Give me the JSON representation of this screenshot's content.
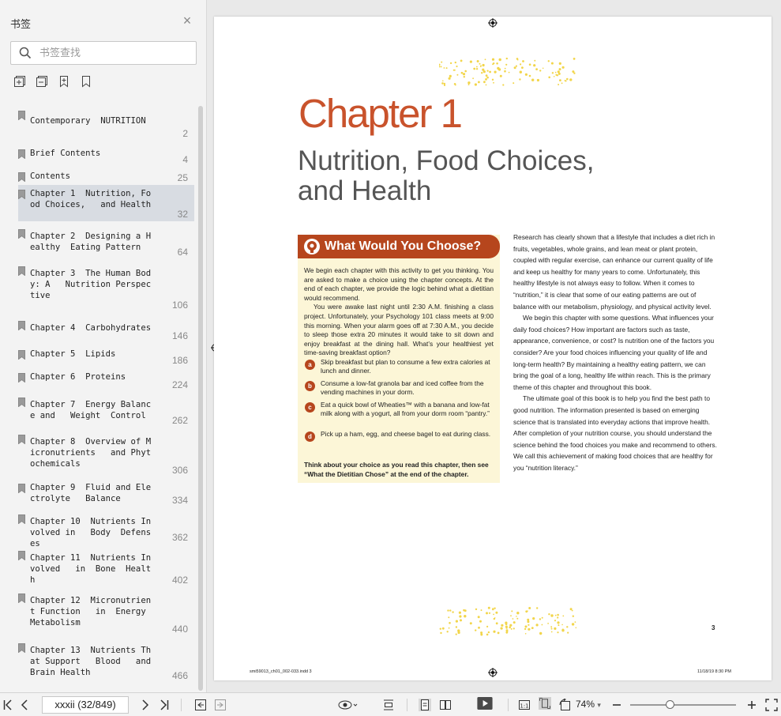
{
  "sidebar": {
    "title": "书签",
    "search_placeholder": "书签查找",
    "items": [
      {
        "lines": [
          "Contemporary  NUTRITION"
        ],
        "page": "2"
      },
      {
        "lines": [
          "Brief Contents"
        ],
        "page": "4"
      },
      {
        "lines": [
          "Contents"
        ],
        "page": "25"
      },
      {
        "lines": [
          "Chapter 1  Nutrition, Fo",
          "od Choices,   and Health"
        ],
        "page": "32",
        "selected": true
      },
      {
        "lines": [
          "Chapter 2  Designing a H",
          "ealthy  Eating Pattern"
        ],
        "page": "64"
      },
      {
        "lines": [
          "Chapter 3  The Human Bod",
          "y: A   Nutrition Perspec",
          "tive"
        ],
        "page": "106"
      },
      {
        "lines": [
          "Chapter 4  Carbohydrates"
        ],
        "page": "146"
      },
      {
        "lines": [
          "Chapter 5  Lipids"
        ],
        "page": "186"
      },
      {
        "lines": [
          "Chapter 6  Proteins"
        ],
        "page": "224"
      },
      {
        "lines": [
          "Chapter 7  Energy Balanc",
          "e and   Weight  Control"
        ],
        "page": "262"
      },
      {
        "lines": [
          "Chapter 8  Overview of M",
          "icronutrients   and Phyt",
          "ochemicals"
        ],
        "page": "306"
      },
      {
        "lines": [
          "Chapter 9  Fluid and Ele",
          "ctrolyte   Balance"
        ],
        "page": "334"
      },
      {
        "lines": [
          "Chapter 10  Nutrients In",
          "volved in   Body  Defens",
          "es"
        ],
        "page": "362"
      },
      {
        "lines": [
          "Chapter 11  Nutrients In",
          "volved   in  Bone  Healt",
          "h"
        ],
        "page": "402"
      },
      {
        "lines": [
          "Chapter 12  Micronutrien",
          "t Function   in  Energy",
          "Metabolism"
        ],
        "page": "440"
      },
      {
        "lines": [
          "Chapter 13  Nutrients Th",
          "at Support   Blood   and",
          "Brain Health"
        ],
        "page": "466"
      }
    ]
  },
  "page": {
    "chapter": "Chapter 1",
    "title_line1": "Nutrition, Food Choices,",
    "title_line2": "and Health",
    "box_title": "What Would You Choose?",
    "box_p1": "We begin each chapter with this activity to get you thinking. You are asked to make a choice using the chapter concepts. At the end of each chapter, we provide the logic behind what a dietitian would recommend.",
    "box_p2": "You were awake last night until 2:30 A.M. finishing a class project. Unfortunately, your Psychology 101 class meets at 9:00 this morning. When your alarm goes off at 7:30 A.M., you decide to sleep those extra 20 minutes it would take to sit down and enjoy breakfast at the dining hall. What’s your healthiest yet time-saving breakfast option?",
    "options": [
      {
        "letter": "a",
        "text": "Skip breakfast but plan to consume a few extra calories at lunch and dinner."
      },
      {
        "letter": "b",
        "text": "Consume a low-fat granola bar and iced coffee from the vending machines in your dorm."
      },
      {
        "letter": "c",
        "text": "Eat a quick bowl of Wheaties™ with a banana and low-fat milk along with a yogurt, all from your dorm room “pantry.”"
      },
      {
        "letter": "d",
        "text": "Pick up a ham, egg, and cheese bagel to eat during class."
      }
    ],
    "box_foot": "Think about your choice as you read this chapter, then see “What the Dietitian Chose” at the end of the chapter.",
    "right_p1": "Research has clearly shown that a lifestyle that includes a diet rich in fruits, vegetables, whole grains, and lean meat or plant protein, coupled with regular exercise, can enhance our current quality of life and keep us healthy for many years to come. Unfortunately, this healthy lifestyle is not always easy to follow. When it comes to “nutrition,” it is clear that some of our eating patterns are out of balance with our metabolism, physiology, and physical activity level.",
    "right_p2": "We begin this chapter with some questions. What influences your daily food choices? How important are factors such as taste, appearance, convenience, or cost? Is nutrition one of the factors you consider? Are your food choices influencing your quality of life and long-term health? By maintaining a healthy eating pattern, we can bring the goal of a long, healthy life within reach. This is the primary theme of this chapter and throughout this book.",
    "right_p3": "The ultimate goal of this book is to help you find the best path to good nutrition. The information presented is based on emerging science that is translated into everyday actions that improve health. After completion of your nutrition course, you should understand the science behind the food choices you make and recommend to others. We call this achievement of making food choices that are healthy for you “nutrition literacy.”",
    "page_number": "3",
    "slug_left": "smi59013_ch01_002-033.indd   3",
    "slug_right": "11/18/19   8:30 PM"
  },
  "toolbar": {
    "page_indicator": "xxxii (32/849)",
    "zoom": "74%"
  },
  "colors": {
    "accent": "#c9532c",
    "box_header": "#b6461d",
    "box_bg": "#fcf6d7",
    "selected": "#d8dce2"
  }
}
